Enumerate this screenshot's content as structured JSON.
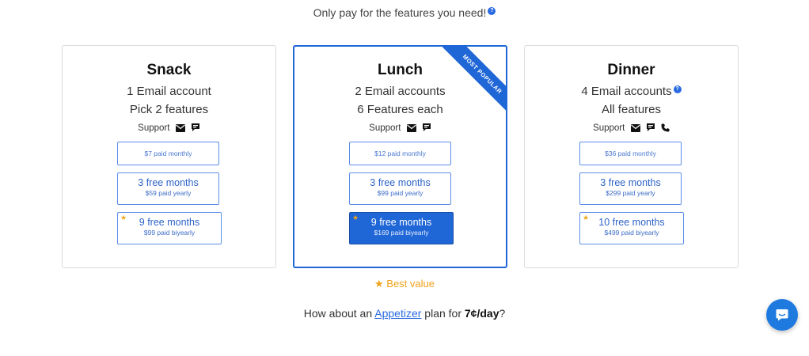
{
  "header": {
    "tagline": "Only pay for the features you need!",
    "help_icon": "?"
  },
  "plans": [
    {
      "name": "Snack",
      "line1": "1 Email account",
      "line2": "Pick 2 features",
      "support_label": "Support",
      "support_icons": [
        "envelope-icon",
        "chat-bubble-icon"
      ],
      "options": [
        {
          "main": "$7 paid monthly"
        },
        {
          "main": "3 free months",
          "sub": "$59 paid yearly"
        },
        {
          "main": "9 free months",
          "sub": "$99 paid biyearly",
          "starred": true
        }
      ]
    },
    {
      "name": "Lunch",
      "ribbon": "MOST POPULAR",
      "line1": "2 Email accounts",
      "line2": "6 Features each",
      "support_label": "Support",
      "support_icons": [
        "envelope-icon",
        "chat-bubble-icon"
      ],
      "options": [
        {
          "main": "$12 paid monthly"
        },
        {
          "main": "3 free months",
          "sub": "$99 paid yearly"
        },
        {
          "main": "9 free months",
          "sub": "$169 paid biyearly",
          "starred": true,
          "selected": true
        }
      ]
    },
    {
      "name": "Dinner",
      "line1": "4 Email accounts",
      "line2": "All features",
      "support_label": "Support",
      "support_icons": [
        "envelope-icon",
        "chat-bubble-icon",
        "phone-icon"
      ],
      "options": [
        {
          "main": "$36 paid monthly"
        },
        {
          "main": "3 free months",
          "sub": "$299 paid yearly"
        },
        {
          "main": "10 free months",
          "sub": "$499 paid biyearly",
          "starred": true
        }
      ]
    }
  ],
  "best_value": "Best value",
  "appetizer": {
    "prefix": "How about an",
    "link": "Appetizer",
    "middle": "plan for",
    "price": "7¢/day",
    "suffix": "?"
  },
  "colors": {
    "accent": "#1f66d6",
    "star": "#f2a41b",
    "chat": "#1f7ae0"
  }
}
